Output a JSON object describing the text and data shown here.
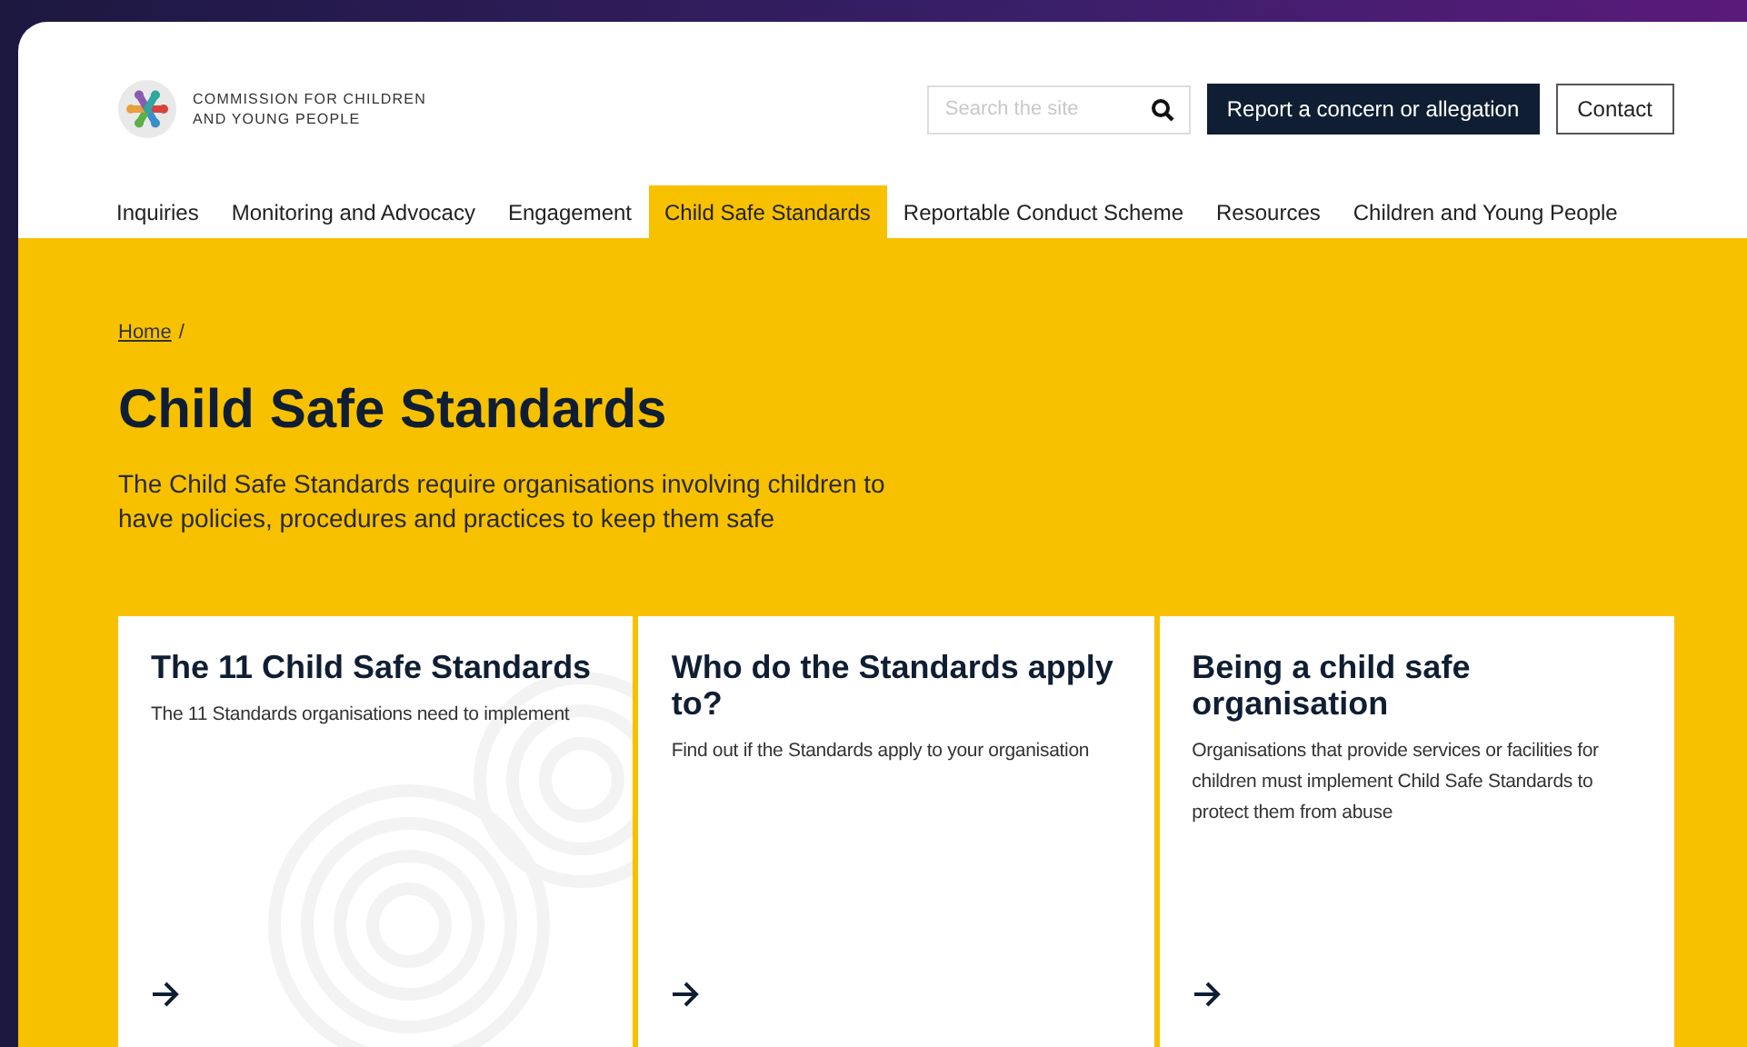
{
  "header": {
    "logo_lines": [
      "COMMISSION FOR CHILDREN",
      "AND YOUNG PEOPLE"
    ],
    "search": {
      "placeholder": "Search the site"
    },
    "buttons": [
      {
        "label": "Report a concern or allegation",
        "kind": "primary"
      },
      {
        "label": "Contact",
        "kind": "outline"
      }
    ]
  },
  "nav": [
    {
      "label": "Inquiries",
      "selected": false
    },
    {
      "label": "Monitoring and Advocacy",
      "selected": false
    },
    {
      "label": "Engagement",
      "selected": false
    },
    {
      "label": "Child Safe Standards",
      "selected": true
    },
    {
      "label": "Reportable Conduct Scheme",
      "selected": false
    },
    {
      "label": "Resources",
      "selected": false
    },
    {
      "label": "Children and Young People",
      "selected": false
    }
  ],
  "breadcrumb": {
    "link": "Home",
    "separator": "/"
  },
  "title": "Child Safe Standards",
  "intro": "The Child Safe Standards require organisations involving children to have policies, procedures and practices to keep them safe",
  "cards": [
    {
      "title": "The 11 Child Safe Standards",
      "text": "The 11 Standards organisations need to implement",
      "pattern": true
    },
    {
      "title": "Who do the Standards apply to?",
      "text": "Find out if the Standards apply to your organisation",
      "pattern": false
    },
    {
      "title": "Being a child safe organisation",
      "text": "Organisations that provide services or facilities for children must implement Child Safe Standards to protect them from abuse",
      "pattern": false
    }
  ]
}
